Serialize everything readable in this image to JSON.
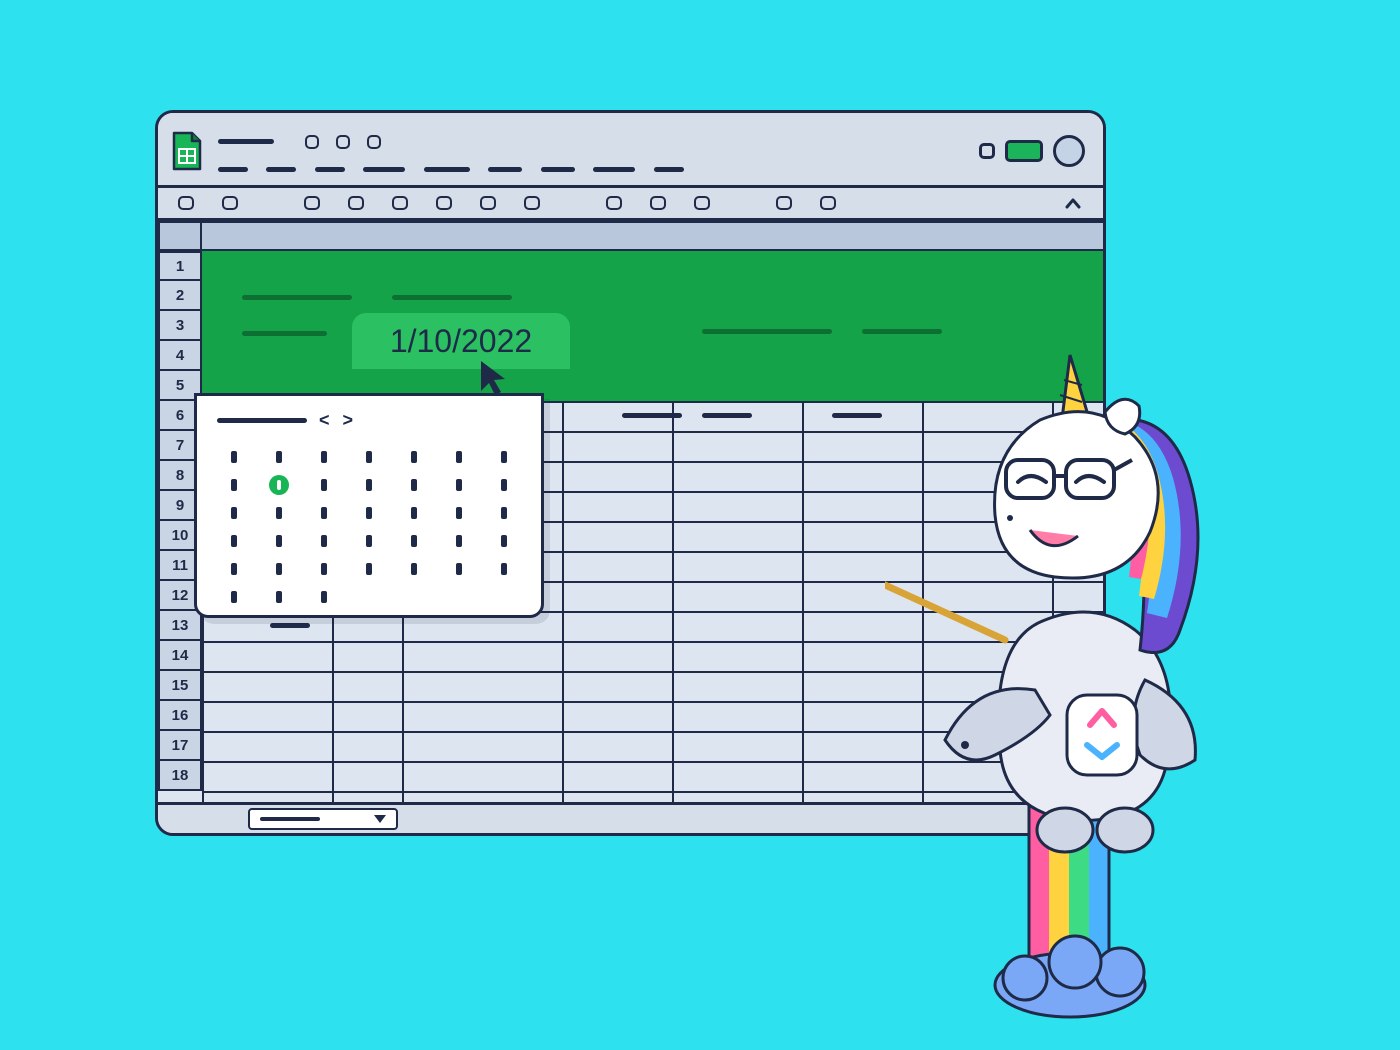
{
  "app": {
    "name": "google-sheets"
  },
  "date_input": {
    "value": "1/10/2022"
  },
  "datepicker": {
    "selected_row": 1,
    "selected_col": 1,
    "rows": 6,
    "cols": 7
  },
  "row_numbers": [
    1,
    2,
    3,
    4,
    5,
    6,
    7,
    8,
    9,
    10,
    11,
    12,
    13,
    14,
    15,
    16,
    17,
    18
  ],
  "toolbar_button_count": 13,
  "colors": {
    "accent_green": "#15A34A",
    "sheet_icon_green": "#18B556",
    "window_bg": "#CFD8E6",
    "outline": "#1E2A47",
    "page_bg": "#2DE1EE"
  },
  "mascot": {
    "brand": "clickup",
    "description": "unicorn-astronaut-pointer"
  }
}
